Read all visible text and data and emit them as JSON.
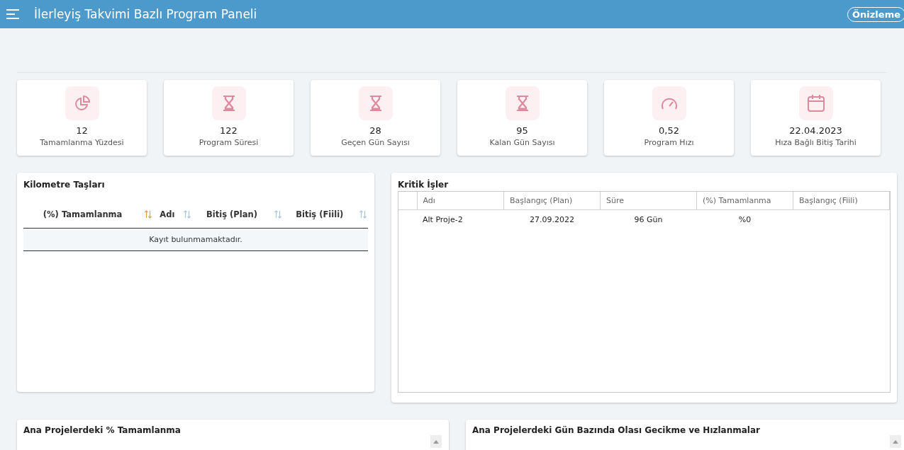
{
  "header": {
    "title": "İlerleyiş Takvimi Bazlı Program Paneli",
    "preview_button": "Önizleme"
  },
  "stats": [
    {
      "kind": "pie",
      "value": "12",
      "label": "Tamamlanma Yüzdesi"
    },
    {
      "kind": "hourglass",
      "value": "122",
      "label": "Program Süresi"
    },
    {
      "kind": "hourglass",
      "value": "28",
      "label": "Geçen Gün Sayısı"
    },
    {
      "kind": "hourglass",
      "value": "95",
      "label": "Kalan Gün Sayısı"
    },
    {
      "kind": "gauge",
      "value": "0,52",
      "label": "Program Hızı"
    },
    {
      "kind": "calendar",
      "value": "22.04.2023",
      "label": "Hıza Bağlı Bitiş Tarihi"
    }
  ],
  "milestones": {
    "title": "Kilometre Taşları",
    "columns": [
      {
        "label": "(%) Tamamlanma",
        "sorted": true
      },
      {
        "label": "Adı",
        "sorted": false
      },
      {
        "label": "Bitiş (Plan)",
        "sorted": false
      },
      {
        "label": "Bitiş (Fiili)",
        "sorted": false
      }
    ],
    "empty_message": "Kayıt bulunmamaktadır."
  },
  "critical": {
    "title": "Kritik İşler",
    "columns": [
      "Adı",
      "Başlangıç (Plan)",
      "Süre",
      "(%) Tamamlanma",
      "Başlangıç (Fiili)"
    ],
    "rows": [
      {
        "cells": [
          "Alt Proje-2",
          "27.09.2022",
          "96 Gün",
          "%0"
        ]
      }
    ]
  },
  "bottom_panels": [
    {
      "title": "Ana Projelerdeki % Tamamlanma"
    },
    {
      "title": "Ana Projelerdeki Gün Bazında Olası Gecikme ve Hızlanmalar"
    }
  ]
}
